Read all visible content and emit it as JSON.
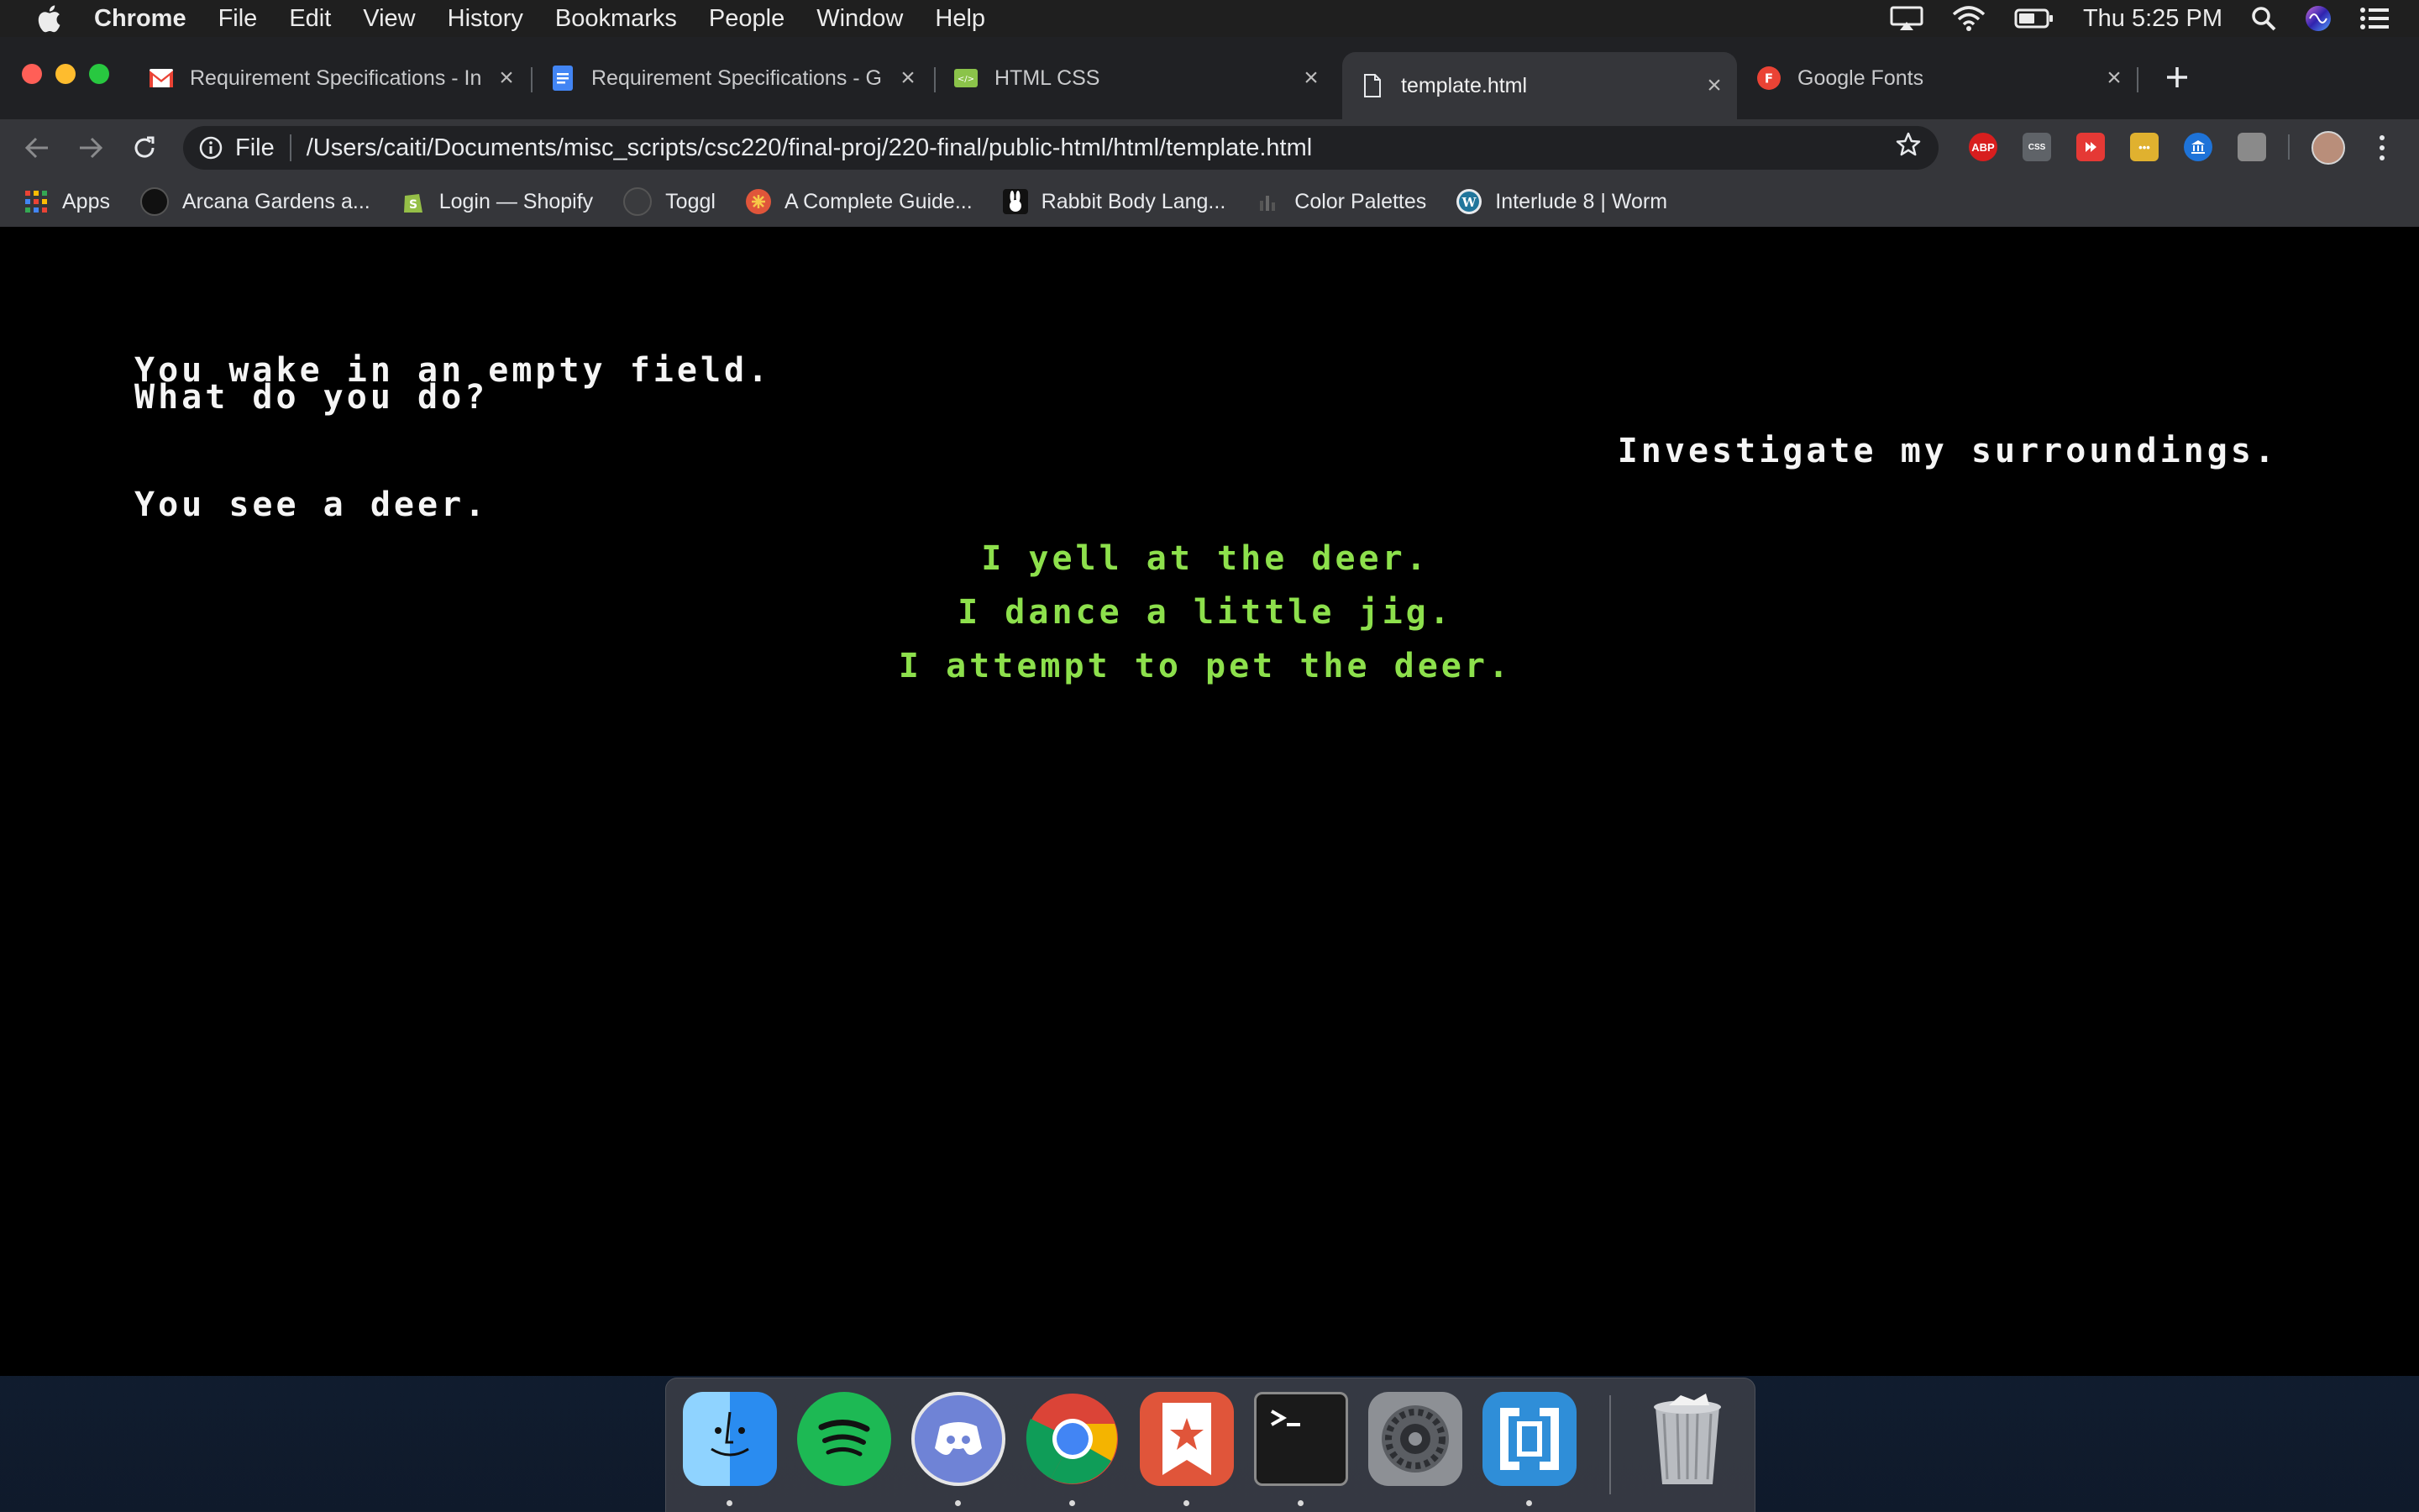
{
  "menubar": {
    "app": "Chrome",
    "items": [
      "File",
      "Edit",
      "View",
      "History",
      "Bookmarks",
      "People",
      "Window",
      "Help"
    ],
    "clock": "Thu 5:25 PM"
  },
  "tabs": [
    {
      "title": "Requirement Specifications - In",
      "icon": "gmail-icon",
      "active": false
    },
    {
      "title": "Requirement Specifications - G",
      "icon": "google-docs-icon",
      "active": false
    },
    {
      "title": "HTML CSS",
      "icon": "html-css-icon",
      "active": false
    },
    {
      "title": "template.html",
      "icon": "file-icon",
      "active": true
    },
    {
      "title": "Google Fonts",
      "icon": "google-fonts-icon",
      "active": false
    }
  ],
  "omnibox": {
    "scheme": "File",
    "url": "/Users/caiti/Documents/misc_scripts/csc220/final-proj/220-final/public-html/html/template.html"
  },
  "extensions": [
    {
      "name": "adblock-icon",
      "label": "ABP",
      "color": "#d81e1e"
    },
    {
      "name": "css-extension-icon",
      "label": "CSS",
      "color": "#5f6368"
    },
    {
      "name": "video-extension-icon",
      "label": "",
      "color": "#e53935"
    },
    {
      "name": "notes-extension-icon",
      "label": "•••",
      "color": "#e0b12f"
    },
    {
      "name": "bank-extension-icon",
      "label": "",
      "color": "#1e73d8"
    },
    {
      "name": "tab-extension-icon",
      "label": "",
      "color": "#8a8a8a"
    }
  ],
  "bookmarks": [
    {
      "label": "Apps",
      "icon": "apps-grid-icon"
    },
    {
      "label": "Arcana Gardens a...",
      "icon": "arcana-icon"
    },
    {
      "label": "Login — Shopify",
      "icon": "shopify-icon"
    },
    {
      "label": "Toggl",
      "icon": "toggl-icon"
    },
    {
      "label": "A Complete Guide...",
      "icon": "guide-icon"
    },
    {
      "label": "Rabbit Body Lang...",
      "icon": "rabbit-icon"
    },
    {
      "label": "Color Palettes",
      "icon": "color-palettes-icon"
    },
    {
      "label": "Interlude 8 | Worm",
      "icon": "wordpress-icon"
    }
  ],
  "game": {
    "story_line_1": "You wake in an empty field.",
    "story_line_2": "What do you do?",
    "player_choice": "Investigate my surroundings.",
    "story_line_3": "You see a deer.",
    "options": [
      "I yell at the deer.",
      "I dance a little jig.",
      "I attempt to pet the deer."
    ],
    "story_color": "#f5f5f5",
    "option_color": "#8de04c"
  },
  "dock": [
    "Finder",
    "Spotify",
    "Discord",
    "Chrome",
    "Wunderlist",
    "Terminal",
    "System Preferences",
    "Brackets",
    "Trash"
  ]
}
